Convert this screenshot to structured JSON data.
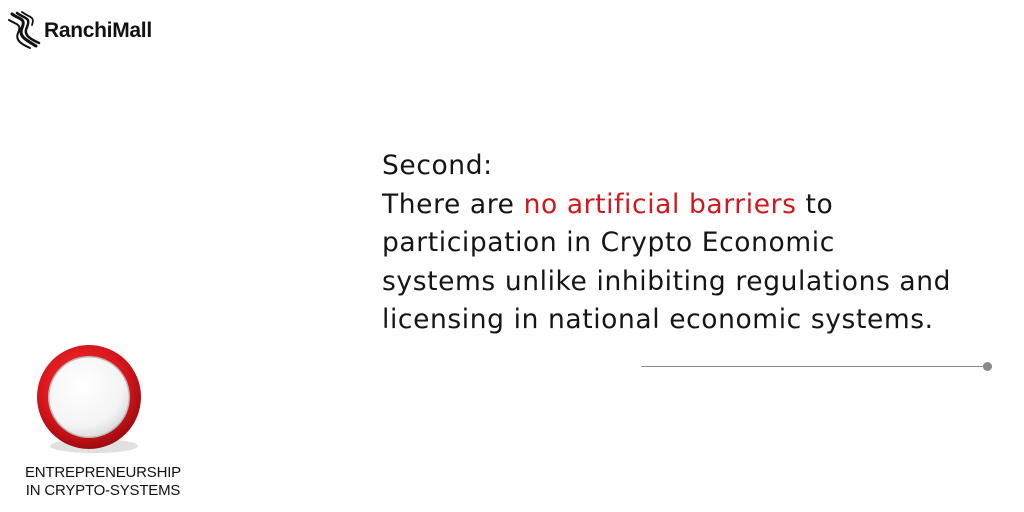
{
  "brand": {
    "logo_text": "RanchiMall",
    "logo_icon": "ranchimall-logo-icon"
  },
  "quote": {
    "heading": "Second:",
    "line1_before": "There are ",
    "line1_highlight": "no artificial barriers",
    "line1_after": " to",
    "line2": "participation in Crypto Economic",
    "line3": "systems unlike inhibiting regulations and",
    "line4": "licensing in national economic systems.",
    "highlight_color": "#d0181e"
  },
  "badge": {
    "caption_line1": "ENTREPRENEURSHIP",
    "caption_line2": "IN CRYPTO-SYSTEMS",
    "ring_color": "#d0181e"
  }
}
